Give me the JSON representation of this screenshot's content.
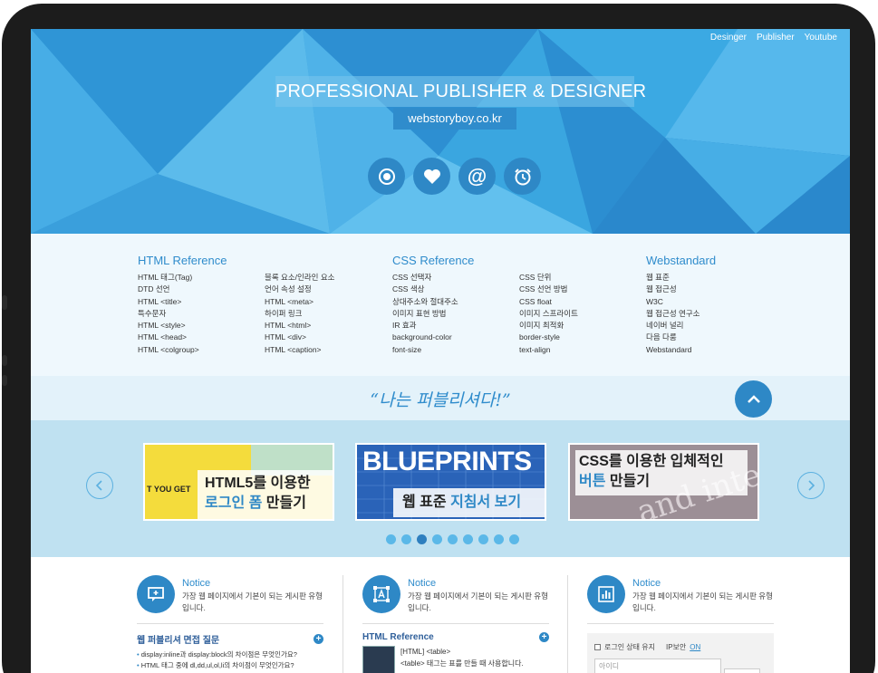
{
  "top_nav": [
    "Desinger",
    "Publisher",
    "Youtube"
  ],
  "hero": {
    "title": "PROFESSIONAL PUBLISHER & DESIGNER",
    "domain": "webstoryboy.co.kr",
    "icons": [
      "target-icon",
      "heart-icon",
      "at-icon",
      "alarm-clock-icon"
    ]
  },
  "references": [
    {
      "title": "HTML Reference",
      "col1": [
        "HTML 태그(Tag)",
        "DTD 선언",
        "HTML <title>",
        "특수문자",
        "HTML <style>",
        "HTML <head>",
        "HTML <colgroup>"
      ],
      "col2": [
        "블록 요소/인라인 요소",
        "언어 속성 설정",
        "HTML <meta>",
        "하이퍼 링크",
        "HTML <html>",
        "HTML <div>",
        "HTML <caption>"
      ]
    },
    {
      "title": "CSS Reference",
      "col1": [
        "CSS 선택자",
        "CSS 색상",
        "상대주소와 절대주소",
        "이미지 표현 방법",
        "IR 효과",
        "background-color",
        "font-size"
      ],
      "col2": [
        "CSS 단위",
        "CSS 선언 방법",
        "CSS float",
        "이미지 스프라이트",
        "이미지 최적화",
        "border-style",
        "text-align"
      ]
    },
    {
      "title": "Webstandard",
      "col1": [
        "웹 표준",
        "웹 접근성",
        "W3C",
        "웹 접근성 연구소",
        "네이버 널리",
        "다음 다룸",
        "Webstandard"
      ],
      "col2": []
    }
  ],
  "quote": "“나는 퍼블리셔다!”",
  "slider": {
    "slides": [
      {
        "tag": "T YOU GET",
        "line1": "HTML5를 이용한",
        "line2_accent": "로그인 폼",
        "line2_rest": " 만들기"
      },
      {
        "tag": "BLUEPRINTS",
        "line1": "",
        "line2_accent": "웹 표준 ",
        "line2_rest": "지침서 보기"
      },
      {
        "tag": "and inte",
        "line1": "CSS를 이용한 입체적인",
        "line2_accent": "버튼",
        "line2_rest": " 만들기"
      }
    ],
    "dot_count": 9,
    "active_dot": 2
  },
  "notices": [
    {
      "title": "Notice",
      "desc": "가장 웹 페이지에서 기본이 되는 게시판 유형입니다.",
      "sub_title": "웹 퍼블리셔 면접 질문",
      "items": [
        "display:inline과 display:block의 차이점은 무엇인가요?",
        "HTML 태그 중에 dl,dd,ul,ol,li의 차이점이 무엇인가요?"
      ]
    },
    {
      "title": "Notice",
      "desc": "가장 웹 페이지에서 기본이 되는 게시판 유형입니다.",
      "sub_title": "HTML Reference",
      "item_title": "[HTML] <table>",
      "item_desc": "<table> 태그는 표를 만들 때 사용합니다."
    },
    {
      "title": "Notice",
      "desc": "가장 웹 페이지에서 기본이 되는 게시판 유형입니다.",
      "login_keep": "로그인 상태 유지",
      "ip_label": "IP보안",
      "ip_state": "ON",
      "id_placeholder": "아이디"
    }
  ],
  "colors": {
    "hero_blue": "#3aa3df",
    "accent_blue": "#2e88c6",
    "title_blue": "#2f8ccc",
    "slider_band": "#bfe1f1"
  }
}
